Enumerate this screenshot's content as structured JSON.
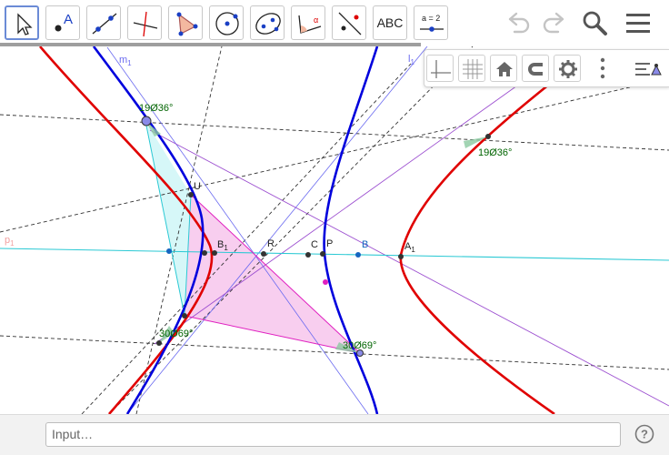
{
  "toolbar": {
    "tools": [
      {
        "name": "move-tool-icon",
        "selected": true
      },
      {
        "name": "point-tool-icon"
      },
      {
        "name": "line-tool-icon"
      },
      {
        "name": "perpendicular-line-tool-icon"
      },
      {
        "name": "polygon-tool-icon"
      },
      {
        "name": "circle-tool-icon"
      },
      {
        "name": "ellipse-tool-icon"
      },
      {
        "name": "angle-tool-icon"
      },
      {
        "name": "reflect-tool-icon"
      },
      {
        "name": "text-tool-icon",
        "label": "ABC"
      },
      {
        "name": "slider-tool-icon",
        "label": "a = 2"
      }
    ],
    "actions": [
      "undo-icon",
      "redo-icon",
      "search-icon",
      "menu-icon"
    ]
  },
  "style_bar": {
    "buttons": [
      "axes-toggle-icon",
      "grid-toggle-icon",
      "home-view-icon",
      "point-capture-icon",
      "settings-icon",
      "more-options-icon",
      "algebra-view-toggle-icon"
    ]
  },
  "graphics": {
    "colors": {
      "hyperbola_red": "#e00000",
      "hyperbola_blue": "#0000dd",
      "purple_line": "#9c4fd0",
      "fill_pink": "#f7c6ec",
      "fill_cyan": "#c8f4f6",
      "angle_text": "#006400",
      "point": "#333333",
      "point_blue": "#1565c0"
    },
    "labels": {
      "m1": "m",
      "m1_sub": "1",
      "l1": "l",
      "l1_sub": "1",
      "p1": "p",
      "p1_sub": "1",
      "u": "U",
      "b1": "B",
      "b1_sub": "1",
      "r": "R",
      "c": "C",
      "p": "P",
      "b": "B",
      "a1": "A",
      "a1_sub": "1",
      "angle_top": "19Ø36°",
      "angle_right": "19Ø36°",
      "angle_bottom_left": "30Ø69°",
      "angle_bottom_right": "30Ø69°"
    }
  },
  "input_bar": {
    "placeholder": "Input…",
    "value": ""
  }
}
